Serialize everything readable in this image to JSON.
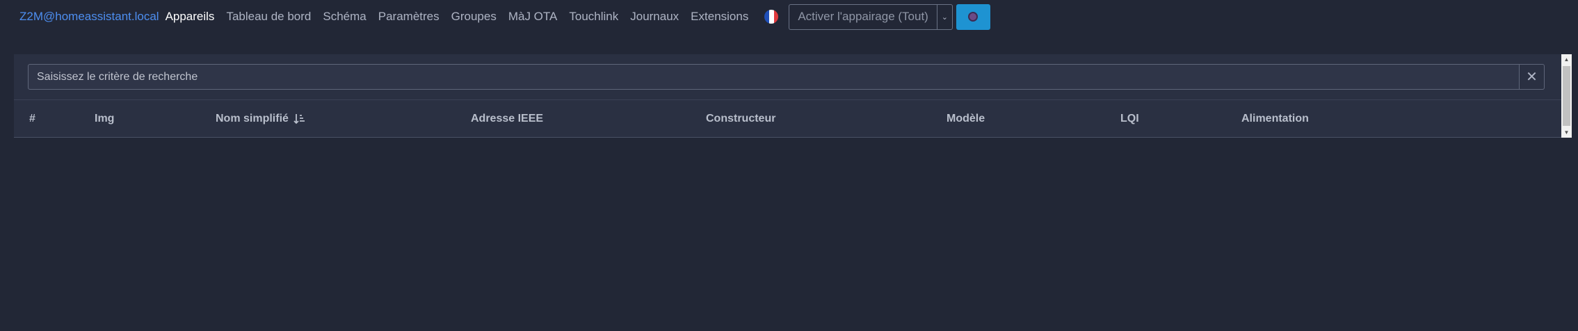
{
  "navbar": {
    "brand": "Z2M@homeassistant.local",
    "items": [
      {
        "label": "Appareils",
        "active": true
      },
      {
        "label": "Tableau de bord"
      },
      {
        "label": "Schéma"
      },
      {
        "label": "Paramètres"
      },
      {
        "label": "Groupes"
      },
      {
        "label": "MàJ OTA"
      },
      {
        "label": "Touchlink"
      },
      {
        "label": "Journaux"
      },
      {
        "label": "Extensions"
      }
    ],
    "language_icon": "french-flag-icon",
    "permit_join_label": "Activer l'appairage (Tout)",
    "permit_join_toggle_icon": "chevron-down-icon",
    "theme_icon": "theme-circle-icon"
  },
  "devices": {
    "search_placeholder": "Saisissez le critère de recherche",
    "search_value": "",
    "clear_icon": "close-icon",
    "columns": {
      "index": "#",
      "img": "Img",
      "friendly_name": "Nom simplifié",
      "ieee": "Adresse IEEE",
      "manufacturer": "Constructeur",
      "model": "Modèle",
      "lqi": "LQI",
      "power": "Alimentation"
    },
    "sort_icon": "sort-ascending-icon",
    "rows": []
  },
  "colors": {
    "background": "#222736",
    "card": "#2a3042",
    "brand": "#4d8ef0",
    "accent_button": "#1e93d2"
  }
}
